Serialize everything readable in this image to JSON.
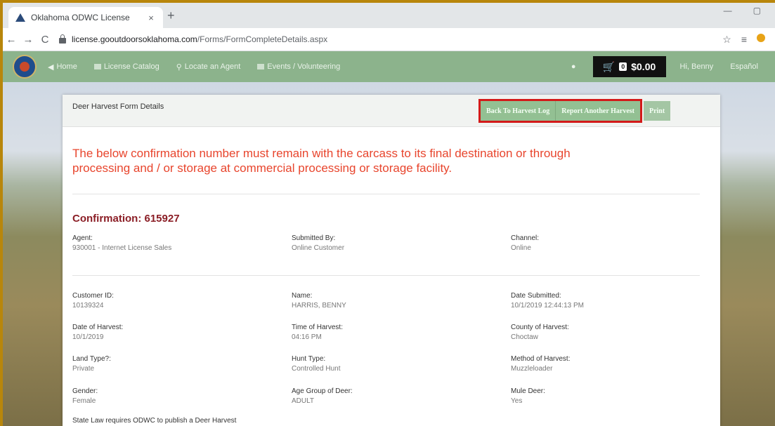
{
  "browser": {
    "tab_title": "Oklahoma ODWC License",
    "tab_close": "×",
    "new_tab": "+",
    "url_host": "license.gooutdoorsoklahoma.com",
    "url_path": "/Forms/FormCompleteDetails.aspx",
    "back": "←",
    "forward": "→",
    "reload": "C",
    "minimize": "—",
    "restore": "▢",
    "star": "☆",
    "extension": "≡"
  },
  "nav": {
    "home": "Home",
    "catalog": "License Catalog",
    "agent": "Locate an Agent",
    "events": "Events / Volunteering",
    "cart_count": "0",
    "cart_total": "$0.00",
    "user": "Hi, Benny",
    "language": "Español"
  },
  "card": {
    "title": "Deer Harvest Form Details",
    "back_button": "Back To Harvest Log",
    "report_button": "Report Another Harvest",
    "print_button": "Print",
    "warning": "The below confirmation number must remain with the carcass to its final destination or through processing and / or storage at commercial processing or storage facility.",
    "confirmation": "Confirmation: 615927"
  },
  "fields": {
    "agent_label": "Agent:",
    "agent_value": "930001 - Internet License Sales",
    "submitted_label": "Submitted By:",
    "submitted_value": "Online Customer",
    "channel_label": "Channel:",
    "channel_value": "Online",
    "customer_label": "Customer ID:",
    "customer_value": "10139324",
    "name_label": "Name:",
    "name_value": "HARRIS, BENNY",
    "date_sub_label": "Date Submitted:",
    "date_sub_value": "10/1/2019 12:44:13 PM",
    "date_harv_label": "Date of Harvest:",
    "date_harv_value": "10/1/2019",
    "time_harv_label": "Time of Harvest:",
    "time_harv_value": "04:16 PM",
    "county_label": "County of Harvest:",
    "county_value": "Choctaw",
    "land_label": "Land Type?:",
    "land_value": "Private",
    "hunt_label": "Hunt Type:",
    "hunt_value": "Controlled Hunt",
    "method_label": "Method of Harvest:",
    "method_value": "Muzzleloader",
    "gender_label": "Gender:",
    "gender_value": "Female",
    "age_label": "Age Group of Deer:",
    "age_value": "ADULT",
    "mule_label": "Mule Deer:",
    "mule_value": "Yes"
  },
  "footer_note": "State Law requires ODWC to publish a Deer Harvest"
}
